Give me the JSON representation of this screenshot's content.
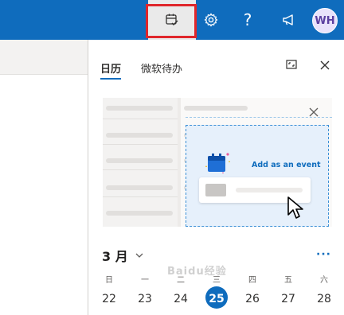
{
  "topbar": {
    "avatar_initials": "WH",
    "help_label": "?",
    "icons": {
      "my_day": "calendar-check-icon",
      "settings": "gear-icon",
      "help": "question-icon",
      "announcements": "megaphone-icon"
    }
  },
  "panel": {
    "tabs": [
      {
        "label": "日历",
        "active": true
      },
      {
        "label": "微软待办",
        "active": false
      }
    ],
    "icons": {
      "expand": "expand-icon",
      "close": "close-icon"
    },
    "illustration": {
      "add_event_text": "Add as an event"
    }
  },
  "calendar": {
    "month_label": "3 月",
    "more_label": "···",
    "weekdays": [
      "日",
      "一",
      "二",
      "三",
      "四",
      "五",
      "六"
    ],
    "days": [
      "22",
      "23",
      "24",
      "25",
      "26",
      "27",
      "28"
    ],
    "today": "25"
  },
  "watermark": "Baidu经验",
  "colors": {
    "brand": "#0f6cbd",
    "highlight": "#e0262b"
  }
}
